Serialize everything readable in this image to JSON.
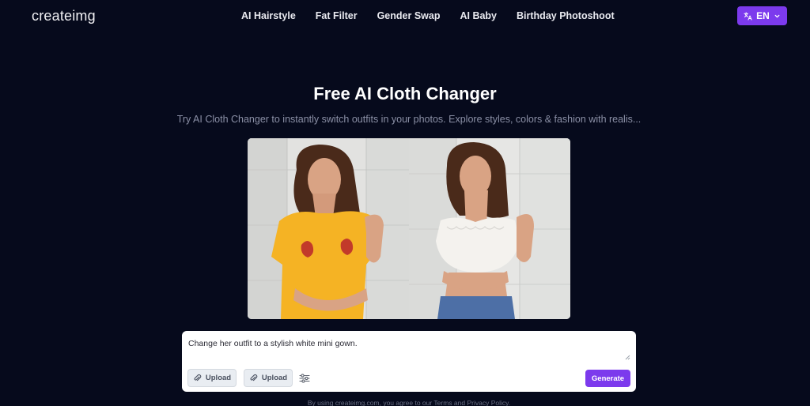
{
  "nav": {
    "logo": "createimg",
    "links": [
      "AI Hairstyle",
      "Fat Filter",
      "Gender Swap",
      "AI Baby",
      "Birthday Photoshoot"
    ],
    "language": "EN"
  },
  "hero": {
    "title": "Free AI Cloth Changer",
    "subtitle": "Try AI Cloth Changer to instantly switch outfits in your photos. Explore styles, colors & fashion with realis..."
  },
  "showcase": {
    "before_image": "woman-yellow-tshirt-photo",
    "after_image": "woman-white-lace-top-photo"
  },
  "prompt": {
    "text": "Change her outfit to a stylish white mini gown.",
    "upload_label_1": "Upload",
    "upload_label_2": "Upload",
    "generate_label": "Generate"
  },
  "footer": {
    "note": "By using createimg.com, you agree to our Terms and Privacy Policy."
  },
  "colors": {
    "background": "#060a1c",
    "accent": "#7c3aed",
    "muted_text": "#8b90a6"
  },
  "icons": [
    "translate-icon",
    "chevron-down-icon",
    "paperclip-icon",
    "sliders-icon"
  ]
}
